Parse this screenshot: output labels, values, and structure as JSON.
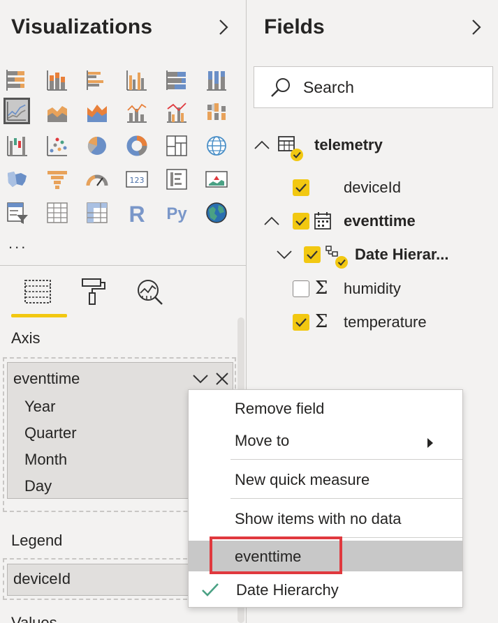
{
  "visualizations": {
    "title": "Visualizations",
    "more_label": "...",
    "icons": [
      "stacked-bar-chart-icon",
      "stacked-column-chart-icon",
      "clustered-bar-chart-icon",
      "clustered-column-chart-icon",
      "100-percent-stacked-bar-chart-icon",
      "100-percent-stacked-column-chart-icon",
      "line-chart-icon",
      "area-chart-icon",
      "stacked-area-chart-icon",
      "line-and-stacked-column-chart-icon",
      "line-and-clustered-column-chart-icon",
      "ribbon-chart-icon",
      "waterfall-chart-icon",
      "scatter-chart-icon",
      "pie-chart-icon",
      "donut-chart-icon",
      "treemap-icon",
      "map-icon",
      "filled-map-icon",
      "funnel-icon",
      "gauge-icon",
      "card-icon",
      "multi-row-card-icon",
      "kpi-icon",
      "slicer-icon",
      "table-icon",
      "matrix-icon",
      "r-visual-icon",
      "python-visual-icon",
      "arcgis-map-icon"
    ],
    "card_text": "123",
    "r_text": "R",
    "py_text": "Py",
    "selected_icon": "line-chart-icon",
    "tabs": [
      "fields-tab-icon",
      "format-paint-roller-icon",
      "analytics-magnifier-icon"
    ]
  },
  "wells": {
    "axis": {
      "label": "Axis",
      "field": "eventtime",
      "hierarchy": [
        "Year",
        "Quarter",
        "Month",
        "Day"
      ]
    },
    "legend": {
      "label": "Legend",
      "field": "deviceId"
    },
    "values": {
      "label": "Values"
    }
  },
  "fields": {
    "title": "Fields",
    "search_placeholder": "Search",
    "table": {
      "name": "telemetry",
      "expanded": true,
      "items": [
        {
          "name": "deviceId",
          "checked": true,
          "type": "text"
        },
        {
          "name": "eventtime",
          "checked": true,
          "type": "date",
          "expanded": true,
          "children": [
            {
              "name": "Date Hierar...",
              "checked": true,
              "type": "hierarchy",
              "expanded": false
            }
          ]
        },
        {
          "name": "humidity",
          "checked": false,
          "type": "sum"
        },
        {
          "name": "temperature",
          "checked": true,
          "type": "sum"
        }
      ]
    }
  },
  "context_menu": {
    "items": [
      {
        "label": "Remove field"
      },
      {
        "label": "Move to",
        "has_submenu": true
      },
      {
        "label": "New quick measure"
      },
      {
        "label": "Show items with no data"
      },
      {
        "label": "eventtime",
        "highlighted": true
      },
      {
        "label": "Date Hierarchy",
        "checked": true
      }
    ]
  },
  "colors": {
    "accent_yellow": "#f2c811",
    "highlight_red": "#e0393e",
    "check_green": "#4aa184"
  }
}
